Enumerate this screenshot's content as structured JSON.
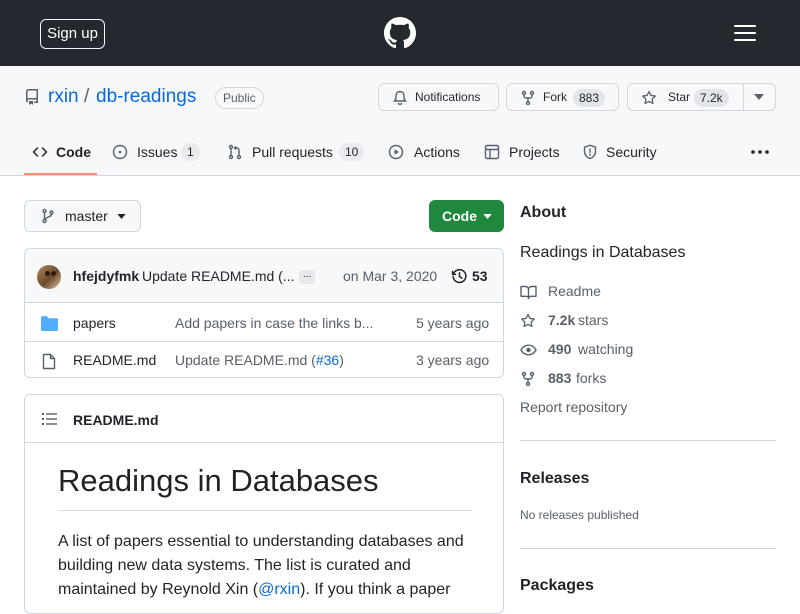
{
  "header": {
    "signup_label": "Sign up"
  },
  "repo": {
    "owner": "rxin",
    "separator": "/",
    "name": "db-readings",
    "visibility": "Public",
    "notifications_label": "Notifications",
    "fork_label": "Fork",
    "fork_count": "883",
    "star_label": "Star",
    "star_count": "7.2k"
  },
  "tabs": [
    {
      "label": "Code",
      "count": ""
    },
    {
      "label": "Issues",
      "count": "1"
    },
    {
      "label": "Pull requests",
      "count": "10"
    },
    {
      "label": "Actions",
      "count": ""
    },
    {
      "label": "Projects",
      "count": ""
    },
    {
      "label": "Security",
      "count": ""
    }
  ],
  "toolbar": {
    "branch": "master",
    "code_label": "Code"
  },
  "commit": {
    "author": "hfejdyfmk",
    "message": "Update README.md (...",
    "ellipsis": "...",
    "date": "on Mar 3, 2020",
    "count": "53"
  },
  "files": [
    {
      "name": "papers",
      "message": "Add papers in case the links b...",
      "message_prefix": "",
      "message_link": "",
      "message_suffix": "",
      "age": "5 years ago"
    },
    {
      "name": "README.md",
      "message": "",
      "message_prefix": "Update README.md (",
      "message_link": "#36",
      "message_suffix": ")",
      "age": "3 years ago"
    }
  ],
  "readme": {
    "filename": "README.md",
    "title": "Readings in Databases",
    "line1": "A list of papers essential to understanding databases and",
    "line2": "building new data systems. The list is curated and",
    "line3_a": "maintained by Reynold Xin (",
    "line3_link": "@rxin",
    "line3_b": "). If you think a paper"
  },
  "about": {
    "heading": "About",
    "description": "Readings in Databases",
    "readme_label": "Readme",
    "stars_count": "7.2k",
    "stars_label": "stars",
    "watching_count": "490",
    "watching_label": "watching",
    "forks_count": "883",
    "forks_label": "forks",
    "report_label": "Report repository"
  },
  "releases": {
    "heading": "Releases",
    "empty": "No releases published"
  },
  "packages": {
    "heading": "Packages"
  },
  "colors": {
    "header_bg": "#24292f",
    "link": "#0969da",
    "code_button": "#1f883d",
    "active_tab_underline": "#fd8c73",
    "folder": "#54aeff"
  }
}
